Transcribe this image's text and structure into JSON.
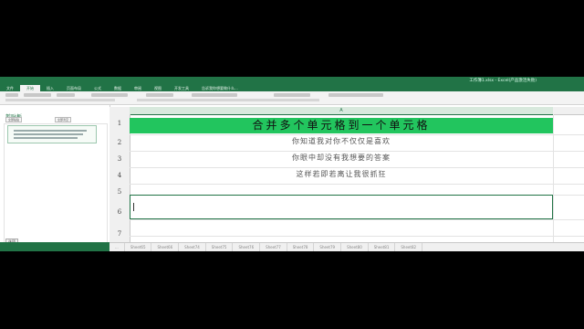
{
  "app": {
    "title": "工作簿1.xlsx - Excel(产品激活失败)"
  },
  "ribbon_tabs": [
    "文件",
    "开始",
    "插入",
    "页面布局",
    "公式",
    "数据",
    "审阅",
    "视图",
    "开发工具",
    "告诉我你想要做什么..."
  ],
  "clipboard_pane": {
    "title": "剪贴板",
    "paste_all": "全部粘贴",
    "clear_all": "全部清空",
    "options": "选项"
  },
  "sheet": {
    "column_header": "A",
    "rows": [
      "1",
      "2",
      "3",
      "4",
      "5",
      "6",
      "7"
    ],
    "title_cell": "合并多个单元格到一个单元格",
    "line2": "你知道我对你不仅仅是喜欢",
    "line3": "你眼中却没有我想要的答案",
    "line4": "这样若即若离让我很抓狂",
    "tabs": [
      "...",
      "Sheet65",
      "Sheet66",
      "Sheet74",
      "Sheet75",
      "Sheet76",
      "Sheet77",
      "Sheet78",
      "Sheet79",
      "Sheet80",
      "Sheet81",
      "Sheet82"
    ]
  },
  "colors": {
    "accent": "#217346",
    "title_fill": "#22c55e"
  }
}
